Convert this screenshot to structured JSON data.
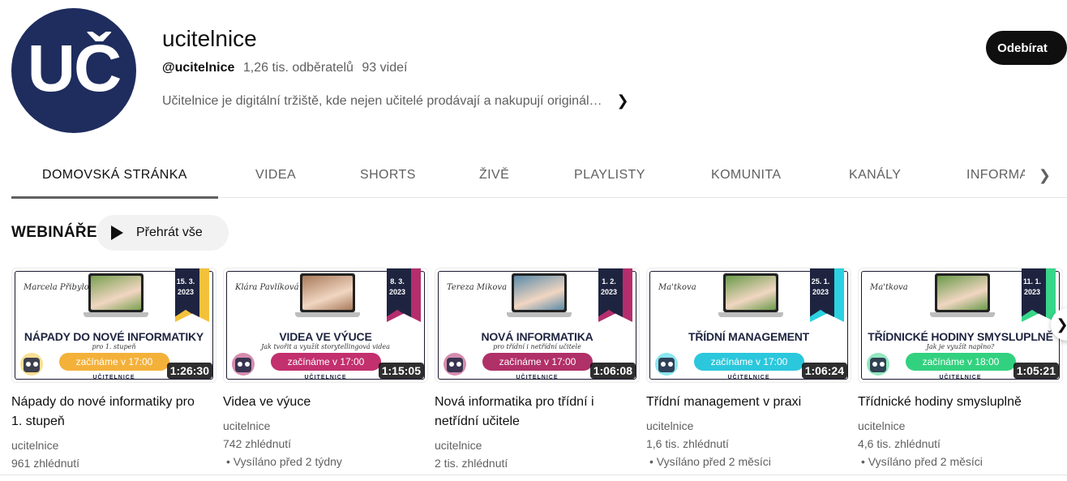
{
  "channel": {
    "name": "ucitelnice",
    "avatar_text": "UČ",
    "handle": "@ucitelnice",
    "subscribers": "1,26 tis. odběratelů",
    "videos": "93 videí",
    "description": "Učitelnice je digitální tržiště, kde nejen učitelé prodávají a nakupují originál…",
    "subscribe_label": "Odebírat",
    "colors": {
      "avatar_bg": "#1e2d5e",
      "subscribe_bg": "#0f0f0f"
    }
  },
  "tabs": [
    {
      "label": "DOMOVSKÁ STRÁNKA",
      "active": true
    },
    {
      "label": "VIDEA"
    },
    {
      "label": "SHORTS"
    },
    {
      "label": "ŽIVĚ"
    },
    {
      "label": "PLAYLISTY"
    },
    {
      "label": "KOMUNITA"
    },
    {
      "label": "KANÁLY"
    },
    {
      "label": "INFORMACE"
    }
  ],
  "tabs_next_icon": "chevron-right-icon",
  "section": {
    "title": "WEBINÁŘE",
    "play_all_label": "Přehrát vše",
    "play_all_icon": "play-icon"
  },
  "videos": [
    {
      "title": "Nápady do nové informatiky pro 1. stupeň",
      "channel": "ucitelnice",
      "views": "961 zhlédnutí",
      "aired": "",
      "duration": "1:26:30",
      "thumb": {
        "signature": "Marcela Přibylová",
        "date": "15. 3. 2023",
        "headline": "NÁPADY DO NOVÉ INFORMATIKY",
        "subline": "pro 1. stupeň",
        "starts": "začínáme v 17:00",
        "brand": "UČITELNICE",
        "ribbon_color": "#f4c23a",
        "pill_color": "#f4b13a",
        "screen_color": "#7aa050"
      }
    },
    {
      "title": "Videa ve výuce",
      "channel": "ucitelnice",
      "views": "742 zhlédnutí",
      "aired": "• Vysíláno před 2 týdny",
      "duration": "1:15:05",
      "thumb": {
        "signature": "Klára Pavlíková",
        "date": "8. 3. 2023",
        "headline": "VIDEA VE VÝUCE",
        "subline": "Jak tvořit a využít storytellingová videa",
        "starts": "začínáme v 17:00",
        "brand": "UČITELNICE",
        "ribbon_color": "#b52d6d",
        "pill_color": "#c2306e",
        "screen_color": "#a87a5a"
      }
    },
    {
      "title": "Nová informatika pro třídní i netřídní učitele",
      "channel": "ucitelnice",
      "views": "2 tis. zhlédnutí",
      "aired": "",
      "duration": "1:06:08",
      "thumb": {
        "signature": "Tereza Mikova",
        "date": "1. 2. 2023",
        "headline": "NOVÁ INFORMATIKA",
        "subline": "pro třídní i netřídní učitele",
        "starts": "začínáme v 17:00",
        "brand": "UČITELNICE",
        "ribbon_color": "#b52d6d",
        "pill_color": "#b03068",
        "screen_color": "#5a8aa8"
      }
    },
    {
      "title": "Třídní management v praxi",
      "channel": "ucitelnice",
      "views": "1,6 tis. zhlédnutí",
      "aired": "• Vysíláno před 2 měsíci",
      "duration": "1:06:24",
      "thumb": {
        "signature": "Ma'tkova",
        "date": "25. 1. 2023",
        "headline": "TŘÍDNÍ MANAGEMENT",
        "subline": "",
        "starts": "začínáme v 17:00",
        "brand": "UČITELNICE",
        "ribbon_color": "#2bd1e0",
        "pill_color": "#2bc7dc",
        "screen_color": "#6a9a4a"
      }
    },
    {
      "title": "Třídnické hodiny smysluplně",
      "channel": "ucitelnice",
      "views": "4,6 tis. zhlédnutí",
      "aired": "• Vysíláno před 2 měsíci",
      "duration": "1:05:21",
      "thumb": {
        "signature": "Ma'tkova",
        "date": "11. 1. 2023",
        "headline": "TŘÍDNICKÉ HODINY SMYSLUPLNĚ",
        "subline": "Jak je využít naplno?",
        "starts": "začínáme v 18:00",
        "brand": "UČITELNICE",
        "ribbon_color": "#38d68a",
        "pill_color": "#32d17f",
        "screen_color": "#6a9a4a"
      }
    }
  ],
  "carousel_next_icon": "chevron-right-icon"
}
